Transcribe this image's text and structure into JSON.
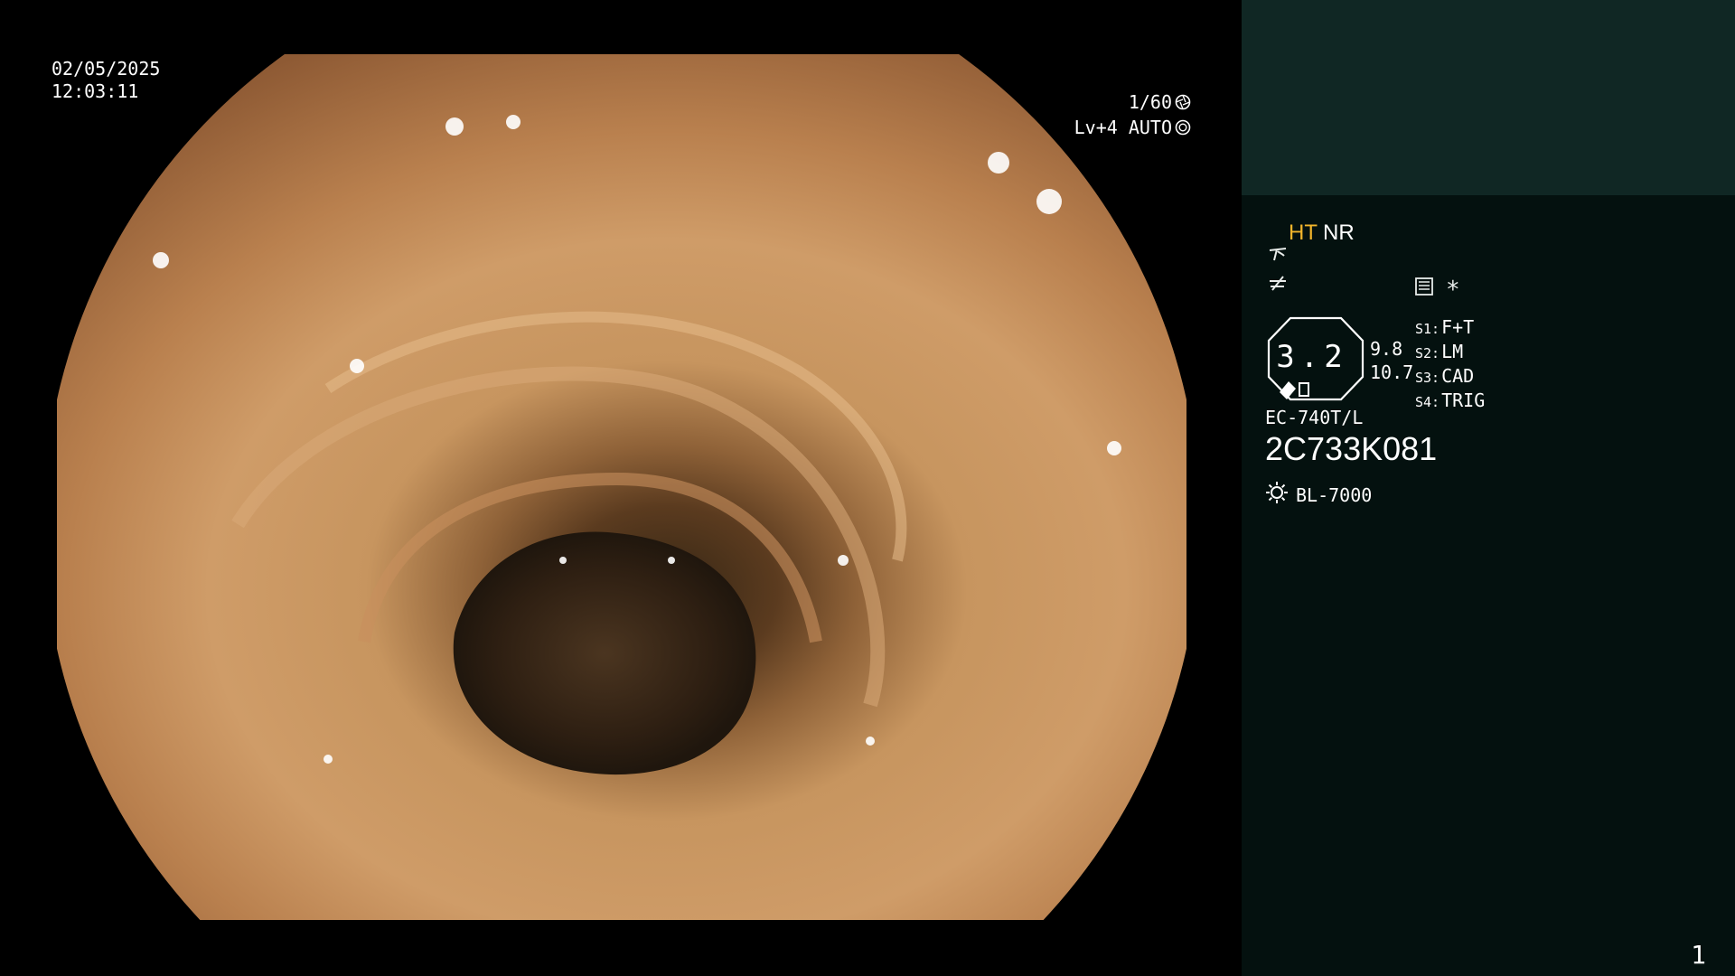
{
  "overlay": {
    "date": "02/05/2025",
    "time": "12:03:11",
    "shutter": "1/60",
    "level": "Lv+4 AUTO"
  },
  "status": {
    "ht": "HT",
    "nr": "NR",
    "asterisk": "*",
    "gauge_value": "3.2",
    "gauge_sub1": "9.8",
    "gauge_sub2": "10.7",
    "settings": [
      {
        "key": "S1:",
        "value": "F+T"
      },
      {
        "key": "S2:",
        "value": "LM"
      },
      {
        "key": "S3:",
        "value": "CAD"
      },
      {
        "key": "S4:",
        "value": "TRIG"
      }
    ],
    "model": "EC-740T/L",
    "serial": "2C733K081",
    "light": "BL-7000",
    "page": "1"
  },
  "colors": {
    "accent": "#f2b52b",
    "panel_top": "#102724",
    "panel": "#04110f"
  },
  "icons": [
    "shutter-icon",
    "auto-exposure-icon",
    "structure-enhance-icon",
    "color-hue-icon",
    "menu-icon",
    "light-source-icon"
  ]
}
